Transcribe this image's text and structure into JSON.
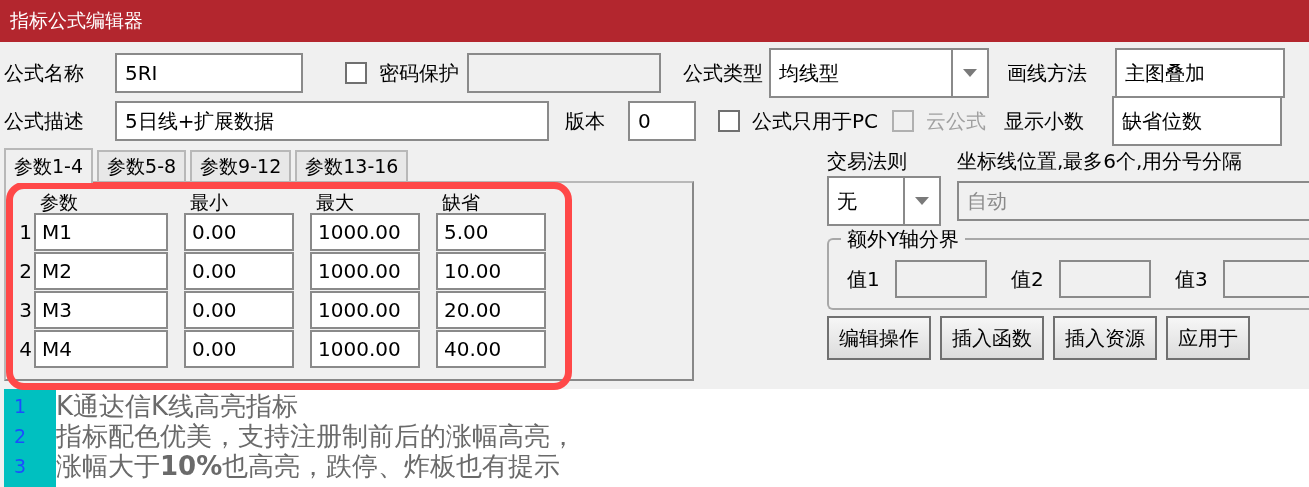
{
  "window": {
    "title": "指标公式编辑器"
  },
  "form": {
    "name": {
      "label": "公式名称",
      "value": "5RI"
    },
    "password": {
      "label": "密码保护",
      "checked": false
    },
    "type": {
      "label": "公式类型",
      "value": "均线型"
    },
    "draw": {
      "label": "画线方法",
      "value": "主图叠加"
    },
    "description": {
      "label": "公式描述",
      "value": "5日线+扩展数据"
    },
    "version": {
      "label": "版本",
      "value": "0"
    },
    "pc_only": {
      "label": "公式只用于PC",
      "checked": false,
      "disabled": false
    },
    "cloud": {
      "label": "云公式",
      "checked": false,
      "disabled": true
    },
    "decimals": {
      "label": "显示小数",
      "value": "缺省位数"
    }
  },
  "tabs": [
    {
      "label": "参数1-4",
      "selected": true
    },
    {
      "label": "参数5-8",
      "selected": false
    },
    {
      "label": "参数9-12",
      "selected": false
    },
    {
      "label": "参数13-16",
      "selected": false
    }
  ],
  "params": {
    "columns": [
      "参数",
      "最小",
      "最大",
      "缺省"
    ],
    "rows": [
      {
        "index": "1",
        "cells": [
          "M1",
          "0.00",
          "1000.00",
          "5.00"
        ]
      },
      {
        "index": "2",
        "cells": [
          "M2",
          "0.00",
          "1000.00",
          "10.00"
        ]
      },
      {
        "index": "3",
        "cells": [
          "M3",
          "0.00",
          "1000.00",
          "20.00"
        ]
      },
      {
        "index": "4",
        "cells": [
          "M4",
          "0.00",
          "1000.00",
          "40.00"
        ]
      }
    ]
  },
  "trade_rule": {
    "label": "交易法则",
    "value": "无"
  },
  "axis_lines": {
    "label": "坐标线位置,最多6个,用分号分隔",
    "value": "自动",
    "disabled": true
  },
  "y_axis": {
    "legend": "额外Y轴分界",
    "fields": [
      {
        "label": "值1"
      },
      {
        "label": "值2"
      },
      {
        "label": "值3"
      }
    ]
  },
  "buttons": [
    "编辑操作",
    "插入函数",
    "插入资源",
    "应用于"
  ],
  "editor": {
    "lines": [
      {
        "number": "1",
        "text": "K通达信K线高亮指标"
      },
      {
        "number": "2",
        "text": "指标配色优美，支持注册制前后的涨幅高亮，"
      },
      {
        "number": "3",
        "text": "涨幅大于**10%**也高亮，跌停、炸板也有提示"
      }
    ]
  }
}
